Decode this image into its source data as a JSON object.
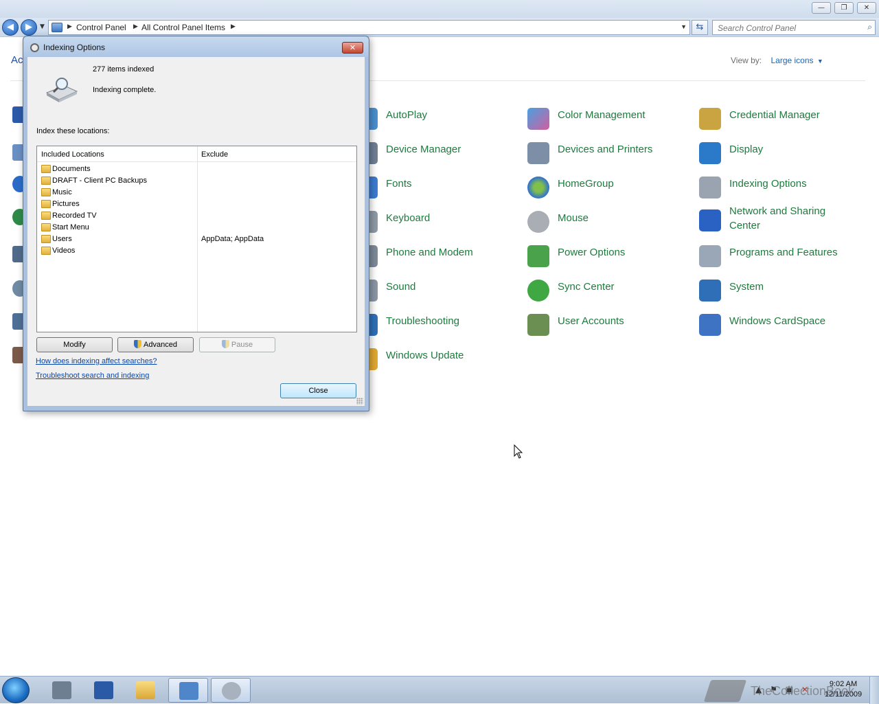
{
  "window": {
    "caption_min": "—",
    "caption_max": "❐",
    "caption_close": "✕"
  },
  "address": {
    "segments": [
      "Control Panel",
      "All Control Panel Items"
    ],
    "search_placeholder": "Search Control Panel"
  },
  "cp": {
    "header_partial": "Ac",
    "view_by_label": "View by:",
    "view_by_value": "Large icons",
    "items": [
      {
        "label": "AutoPlay",
        "icon": "autoplay-icon",
        "color": "#4a8fcf"
      },
      {
        "label": "Color Management",
        "icon": "color-management-icon",
        "color": "#d05fa0"
      },
      {
        "label": "Credential Manager",
        "icon": "credential-manager-icon",
        "color": "#c9a441"
      },
      {
        "label": "Device Manager",
        "icon": "device-manager-icon",
        "color": "#6f7f94"
      },
      {
        "label": "Devices and Printers",
        "icon": "devices-printers-icon",
        "color": "#7d8fa6"
      },
      {
        "label": "Display",
        "icon": "display-icon",
        "color": "#2b79c9"
      },
      {
        "label": "Fonts",
        "icon": "fonts-icon",
        "color": "#3d7bd0"
      },
      {
        "label": "HomeGroup",
        "icon": "homegroup-icon",
        "color": "#2f6fd1"
      },
      {
        "label": "Indexing Options",
        "icon": "indexing-options-icon",
        "color": "#9aa4b0"
      },
      {
        "label": "Keyboard",
        "icon": "keyboard-icon",
        "color": "#8f9aa6"
      },
      {
        "label": "Mouse",
        "icon": "mouse-icon",
        "color": "#a9aeb4"
      },
      {
        "label": "Network and Sharing Center",
        "icon": "network-sharing-icon",
        "color": "#2a62c4"
      },
      {
        "label": "Phone and Modem",
        "icon": "phone-modem-icon",
        "color": "#7d8a98"
      },
      {
        "label": "Power Options",
        "icon": "power-options-icon",
        "color": "#4aa34a"
      },
      {
        "label": "Programs and Features",
        "icon": "programs-features-icon",
        "color": "#9aa7b6"
      },
      {
        "label": "Sound",
        "icon": "sound-icon",
        "color": "#8a96a4"
      },
      {
        "label": "Sync Center",
        "icon": "sync-center-icon",
        "color": "#3fa843"
      },
      {
        "label": "System",
        "icon": "system-icon",
        "color": "#2f6fb7"
      },
      {
        "label": "Troubleshooting",
        "icon": "troubleshooting-icon",
        "color": "#2f6fb7"
      },
      {
        "label": "User Accounts",
        "icon": "user-accounts-icon",
        "color": "#6b8f53"
      },
      {
        "label": "Windows CardSpace",
        "icon": "cardspace-icon",
        "color": "#3e73c4"
      },
      {
        "label": "Windows Update",
        "icon": "windows-update-icon",
        "color": "#e0a830"
      }
    ]
  },
  "dialog": {
    "title": "Indexing Options",
    "close_glyph": "✕",
    "items_indexed": "277 items indexed",
    "status": "Indexing complete.",
    "locations_label": "Index these locations:",
    "columns": {
      "included": "Included Locations",
      "exclude": "Exclude"
    },
    "locations": [
      {
        "name": "Documents",
        "exclude": ""
      },
      {
        "name": "DRAFT - Client PC Backups",
        "exclude": ""
      },
      {
        "name": "Music",
        "exclude": ""
      },
      {
        "name": "Pictures",
        "exclude": ""
      },
      {
        "name": "Recorded TV",
        "exclude": ""
      },
      {
        "name": "Start Menu",
        "exclude": ""
      },
      {
        "name": "Users",
        "exclude": "AppData; AppData"
      },
      {
        "name": "Videos",
        "exclude": ""
      }
    ],
    "buttons": {
      "modify": "Modify",
      "advanced": "Advanced",
      "pause": "Pause",
      "close": "Close"
    },
    "links": {
      "how": "How does indexing affect searches?",
      "troubleshoot": "Troubleshoot search and indexing"
    }
  },
  "taskbar": {
    "time": "9:02 AM",
    "date": "12/11/2009",
    "watermark": "TheCollectionBook"
  }
}
